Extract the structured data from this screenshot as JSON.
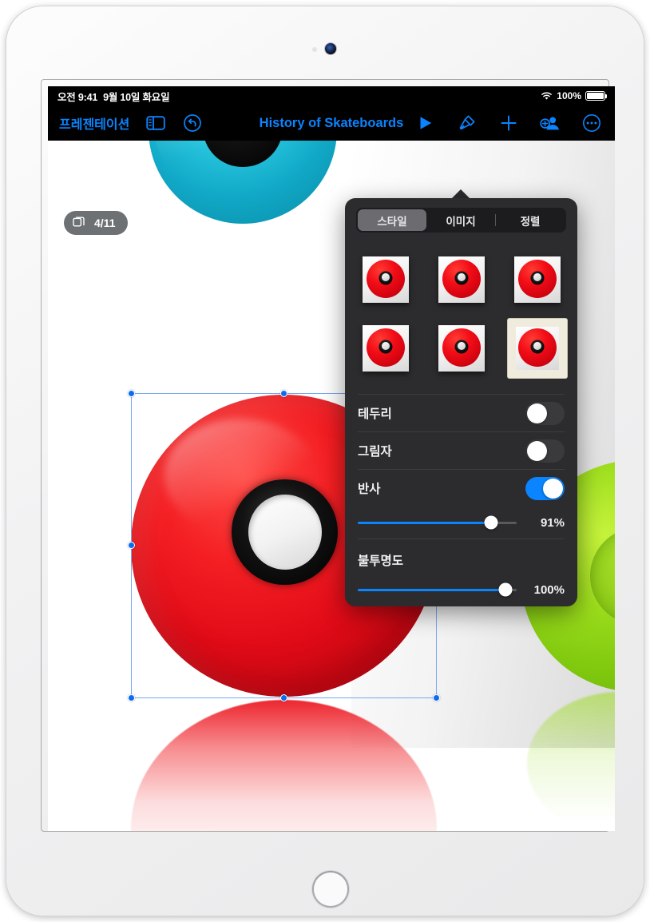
{
  "status_bar": {
    "time": "오전 9:41",
    "date": "9월 10일 화요일",
    "wifi_icon": "wifi-icon",
    "battery_percent": "100%",
    "battery_icon": "battery-full-icon"
  },
  "toolbar": {
    "presentations_label": "프레젠테이션",
    "navigator_icon": "sidebar-panel-icon",
    "undo_icon": "undo-arrow-icon",
    "document_title": "History of Skateboards",
    "play_icon": "play-triangle-icon",
    "format_icon": "paintbrush-icon",
    "insert_icon": "plus-icon",
    "collaborate_icon": "add-person-icon",
    "more_icon": "ellipsis-circle-icon"
  },
  "canvas": {
    "slide_badge": {
      "icon": "slides-stack-icon",
      "counter": "4/11"
    }
  },
  "format_panel": {
    "tabs": [
      {
        "label": "스타일",
        "selected": true
      },
      {
        "label": "이미지",
        "selected": false
      },
      {
        "label": "정렬",
        "selected": false
      }
    ],
    "style_thumbnails": [
      {
        "name": "style-preset-1",
        "selected": false
      },
      {
        "name": "style-preset-2",
        "selected": false
      },
      {
        "name": "style-preset-3",
        "selected": false
      },
      {
        "name": "style-preset-4",
        "selected": false
      },
      {
        "name": "style-preset-5",
        "selected": false
      },
      {
        "name": "style-preset-6",
        "selected": true
      }
    ],
    "border": {
      "label": "테두리",
      "enabled": false
    },
    "shadow": {
      "label": "그림자",
      "enabled": false
    },
    "reflection": {
      "label": "반사",
      "enabled": true,
      "value": "91%",
      "percent": 91
    },
    "opacity": {
      "label": "불투명도",
      "value": "100%",
      "percent": 100
    }
  },
  "colors": {
    "accent_blue": "#0a84ff",
    "panel_background": "#2c2c2e",
    "selection_blue": "#0a6cf1",
    "selected_thumb_border": "#efebdd"
  }
}
